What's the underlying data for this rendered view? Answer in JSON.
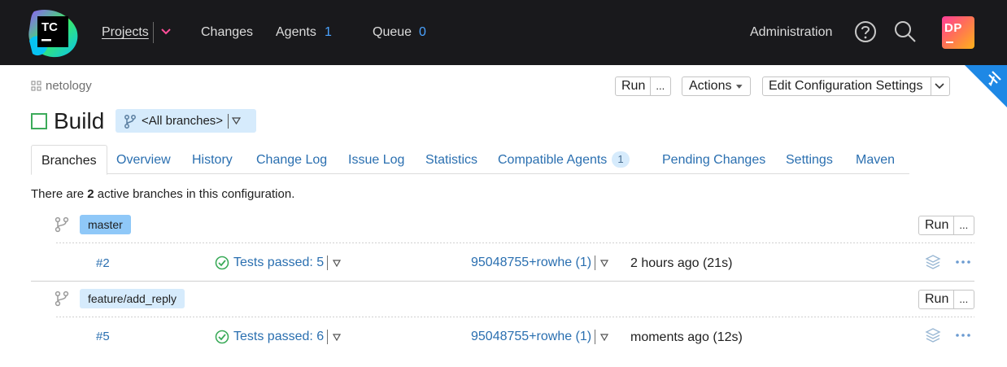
{
  "topbar": {
    "logo_text": "TC",
    "projects": "Projects",
    "changes": "Changes",
    "agents_label": "Agents",
    "agents_count": "1",
    "queue_label": "Queue",
    "queue_count": "0",
    "administration": "Administration",
    "avatar_initials": "DP",
    "icons": [
      "help-icon",
      "search-icon"
    ]
  },
  "breadcrumb": {
    "project": "netology"
  },
  "header": {
    "title": "Build",
    "branch_selector": "<All branches>",
    "run_label": "Run",
    "run_more": "...",
    "actions_label": "Actions",
    "edit_config_label": "Edit Configuration Settings"
  },
  "tabs": [
    {
      "label": "Branches",
      "active": true
    },
    {
      "label": "Overview"
    },
    {
      "label": "History"
    },
    {
      "label": "Change Log"
    },
    {
      "label": "Issue Log"
    },
    {
      "label": "Statistics"
    },
    {
      "label": "Compatible Agents",
      "badge": "1"
    },
    {
      "label": "Pending Changes"
    },
    {
      "label": "Settings"
    },
    {
      "label": "Maven"
    }
  ],
  "summary": {
    "prefix": "There are",
    "count": "2",
    "suffix": "active branches in this configuration."
  },
  "branches": [
    {
      "name": "master",
      "run_label": "Run",
      "more_label": "...",
      "build": {
        "number": "#2",
        "status": "Tests passed: 5",
        "changes": "95048755+rowhe (1)",
        "time": "2 hours ago (21s)"
      }
    },
    {
      "name": "feature/add_reply",
      "run_label": "Run",
      "more_label": "...",
      "build": {
        "number": "#5",
        "status": "Tests passed: 6",
        "changes": "95048755+rowhe (1)",
        "time": "moments ago (12s)"
      }
    }
  ],
  "colors": {
    "topbar_bg": "#19191c",
    "link": "#2a6fb0",
    "success": "#3cab5a",
    "branch_tag_default": "#8fc8f8",
    "branch_tag": "#d6ebfc",
    "corner_ribbon": "#1e88e5"
  }
}
